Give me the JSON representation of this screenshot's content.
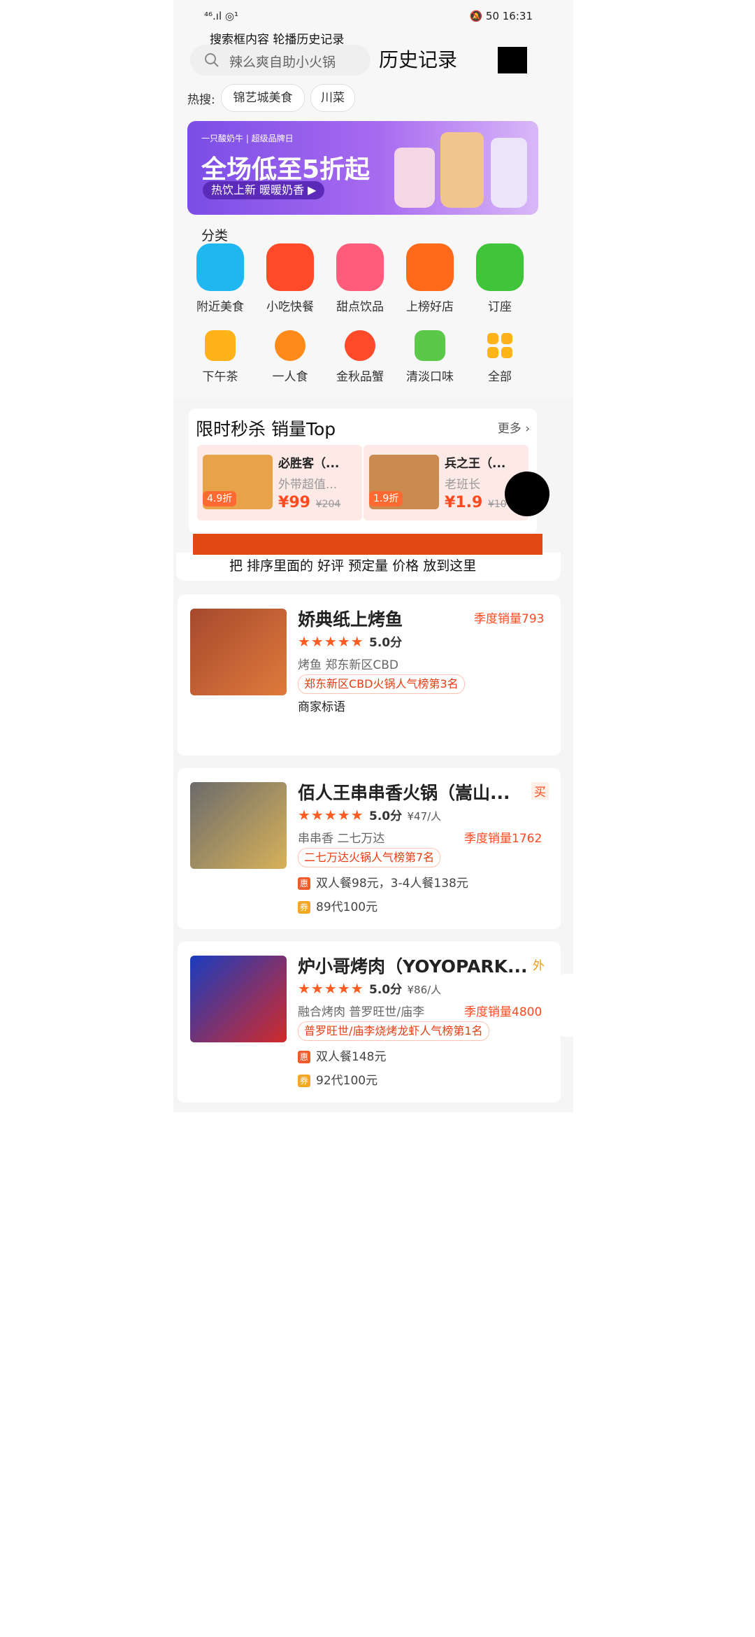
{
  "status": {
    "left": "⁴⁶.ıl ◎¹",
    "right": "🔕 50 16:31"
  },
  "annotations": {
    "top": "搜索框内容 轮播历史记录",
    "history": "历史记录",
    "bottom_note": "把 排序里面的 好评 预定量 价格 放到这里"
  },
  "search": {
    "placeholder": "辣么爽自助小火锅"
  },
  "hot": {
    "label": "热搜:",
    "chips": [
      "锦艺城美食",
      "川菜"
    ]
  },
  "banner": {
    "brand": "一只酸奶牛 | 超级品牌日",
    "headline": "全场低至5折起",
    "pill": "热饮上新 暖暖奶香 ▶"
  },
  "category_title": "分类",
  "categories_row1": [
    {
      "label": "附近美食",
      "color": "#1fb7f0",
      "icon": "chef-hat-icon"
    },
    {
      "label": "小吃快餐",
      "color": "#ff4a2a",
      "icon": "fries-icon"
    },
    {
      "label": "甜点饮品",
      "color": "#ff5b7a",
      "icon": "cup-heart-icon"
    },
    {
      "label": "上榜好店",
      "color": "#ff6a1a",
      "icon": "fire-icon"
    },
    {
      "label": "订座",
      "color": "#3fc43a",
      "icon": "seat-check-icon"
    }
  ],
  "categories_row2": [
    {
      "label": "下午茶",
      "color": "#ffb31a",
      "icon": "tea-cup-icon"
    },
    {
      "label": "一人食",
      "color": "#ff8a1a",
      "icon": "bowl-icon"
    },
    {
      "label": "金秋品蟹",
      "color": "#ff4a2a",
      "icon": "crab-icon"
    },
    {
      "label": "清淡口味",
      "color": "#5cc84a",
      "icon": "salad-icon"
    },
    {
      "label": "全部",
      "color": "#ffb31a",
      "icon": "grid-icon"
    }
  ],
  "flash": {
    "title": "限时秒杀 销量Top",
    "more": "更多 ›",
    "items": [
      {
        "name": "必胜客（...",
        "sub": "外带超值...",
        "price": "99",
        "old": "204",
        "discount": "4.9折"
      },
      {
        "name": "兵之王（...",
        "sub": "老班长",
        "price": "1.9",
        "old": "10",
        "discount": "1.9折"
      }
    ]
  },
  "shops": [
    {
      "title": "娇典纸上烤鱼",
      "tag": "季度销量793",
      "rating": "5.0分",
      "per": "",
      "cat": "烤鱼  郑东新区CBD",
      "sales": "",
      "rank": "郑东新区CBD火锅人气榜第3名",
      "extra": "商家标语",
      "deal1": "",
      "deal2": "",
      "side": ""
    },
    {
      "title": "佰人王串串香火锅（嵩山...",
      "tag": "买",
      "rating": "5.0分",
      "per": "¥47/人",
      "cat": "串串香  二七万达",
      "sales": "季度销量1762",
      "rank": "二七万达火锅人气榜第7名",
      "extra": "",
      "deal1": "双人餐98元，3-4人餐138元",
      "deal2": "89代100元",
      "side": ""
    },
    {
      "title": "炉小哥烤肉（YOYOPARK...",
      "tag": "外",
      "rating": "5.0分",
      "per": "¥86/人",
      "cat": "融合烤肉  普罗旺世/庙李",
      "sales": "季度销量4800",
      "rank": "普罗旺世/庙李烧烤龙虾人气榜第1名",
      "extra": "",
      "deal1": "双人餐148元",
      "deal2": "92代100元",
      "side": ""
    }
  ],
  "badges": {
    "hui": "惠",
    "quan": "券"
  },
  "stars": "★★★★★"
}
